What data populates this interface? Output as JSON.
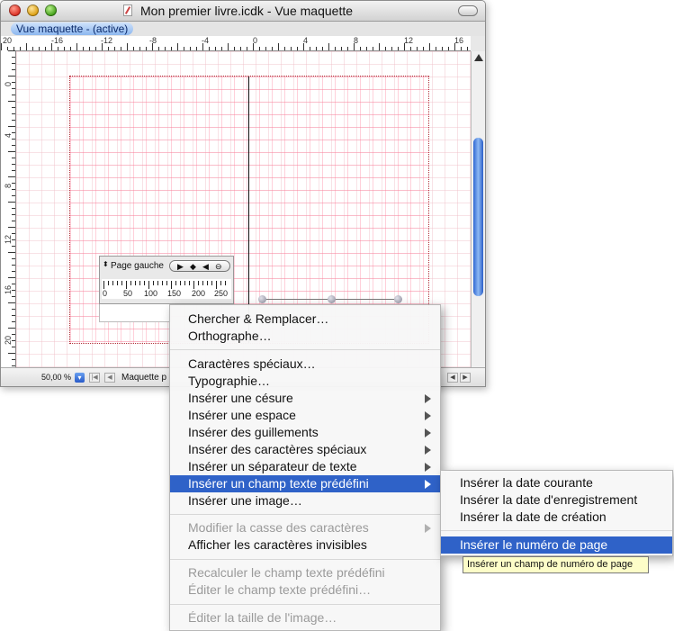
{
  "window": {
    "title": "Mon premier livre.icdk - Vue maquette",
    "view_tab": "Vue maquette - (active)"
  },
  "rulers": {
    "horizontal": [
      "20",
      "-16",
      "-12",
      "-8",
      "-4",
      "0",
      "4",
      "8",
      "12",
      "16"
    ],
    "vertical": [
      "0",
      "4",
      "8",
      "12",
      "16",
      "20"
    ]
  },
  "status": {
    "zoom": "50,00 %",
    "page_label": "Maquette p"
  },
  "palette": {
    "label": "Page gauche",
    "stepper": "⬍",
    "controls": [
      "▶",
      "◆",
      "◀",
      "⊖"
    ],
    "ruler_numbers": [
      "0",
      "50",
      "100",
      "150",
      "200",
      "250"
    ]
  },
  "context_menu": {
    "items": [
      {
        "label": "Chercher & Remplacer…",
        "state": "enabled",
        "submenu": false
      },
      {
        "label": "Orthographe…",
        "state": "enabled",
        "submenu": false
      },
      {
        "label": "Caractères spéciaux…",
        "state": "enabled",
        "submenu": false
      },
      {
        "label": "Typographie…",
        "state": "enabled",
        "submenu": false
      },
      {
        "label": "Insérer une césure",
        "state": "enabled",
        "submenu": true
      },
      {
        "label": "Insérer une espace",
        "state": "enabled",
        "submenu": true
      },
      {
        "label": "Insérer des guillements",
        "state": "enabled",
        "submenu": true
      },
      {
        "label": "Insérer des caractères spéciaux",
        "state": "enabled",
        "submenu": true
      },
      {
        "label": "Insérer un séparateur de texte",
        "state": "enabled",
        "submenu": true
      },
      {
        "label": "Insérer un champ texte prédéfini",
        "state": "selected",
        "submenu": true
      },
      {
        "label": "Insérer une image…",
        "state": "enabled",
        "submenu": false
      },
      {
        "label": "Modifier la casse des caractères",
        "state": "disabled",
        "submenu": true
      },
      {
        "label": "Afficher les caractères invisibles",
        "state": "enabled",
        "submenu": false
      },
      {
        "label": "Recalculer le champ texte prédéfini",
        "state": "disabled",
        "submenu": false
      },
      {
        "label": "Éditer le champ texte prédéfini…",
        "state": "disabled",
        "submenu": false
      },
      {
        "label": "Éditer la taille de l'image…",
        "state": "disabled",
        "submenu": false
      }
    ]
  },
  "submenu": {
    "items": [
      {
        "label": "Insérer la date courante",
        "state": "enabled"
      },
      {
        "label": "Insérer la date d'enregistrement",
        "state": "enabled"
      },
      {
        "label": "Insérer la date de création",
        "state": "enabled"
      },
      {
        "label": "Insérer le numéro de page",
        "state": "selected"
      }
    ]
  },
  "tooltip": "Insérer un champ de numéro de page",
  "colors": {
    "selection": "#2f62c8",
    "tooltip_bg": "#fdfdc8",
    "grid_pink": "#f0bec8"
  }
}
